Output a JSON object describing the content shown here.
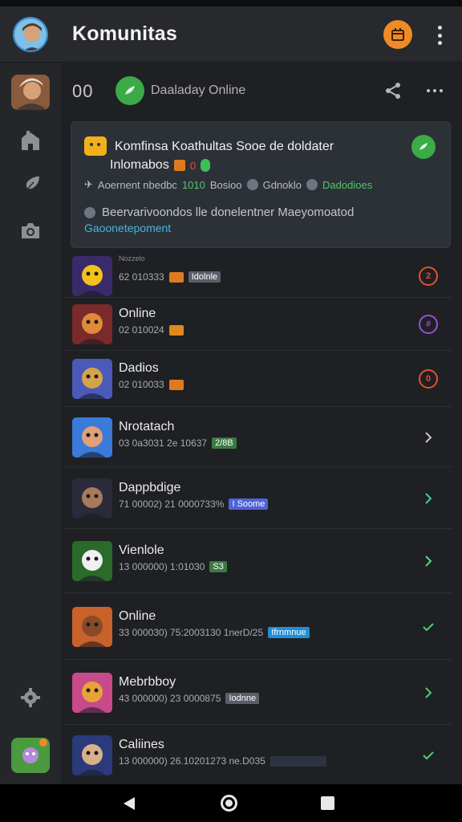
{
  "app": {
    "title": "Komunitas"
  },
  "channel": {
    "id": "00",
    "name": "Daaladay Online"
  },
  "card": {
    "title_line1": "Komfinsa Koathultas Sooe de doldater",
    "title_line2": "Inlomabos",
    "title_badge_num": "0",
    "meta_left": "Aoernent nbedbc",
    "meta_num": "1010",
    "meta_mid": "Bosioo",
    "meta_right": "Gdnoklo",
    "meta_green": "Dadodioes",
    "desc": "Beervarivoondos lle donelentner Maeyomoatod",
    "link": "Gaoonetepoment"
  },
  "rows": [
    {
      "name": "",
      "title_small": "Nozzelo",
      "sub": "62 010333",
      "tags": [
        {
          "text": "",
          "color": "#e07a1f"
        },
        {
          "text": "Idolnle",
          "color": "#5a5f6a"
        }
      ],
      "indicator": {
        "type": "circle",
        "text": "2",
        "color": "#e2522e"
      }
    },
    {
      "name": "Online",
      "sub": "02 010024",
      "tags": [
        {
          "text": "",
          "color": "#e0891f"
        }
      ],
      "indicator": {
        "type": "circle",
        "text": "#",
        "color": "#9b4fd6"
      }
    },
    {
      "name": "Dadios",
      "sub": "02 010033",
      "tags": [
        {
          "text": "",
          "color": "#e07a1f"
        }
      ],
      "indicator": {
        "type": "circle",
        "text": "0",
        "color": "#e2522e"
      }
    },
    {
      "name": "Nrotatach",
      "sub": "03 0a3031 2e 10637",
      "tags": [
        {
          "text": "2/8B",
          "color": "#3c7a44"
        }
      ],
      "indicator": {
        "type": "chevron",
        "color": "#c8c8cc"
      }
    },
    {
      "name": "Dappbdige",
      "sub": "71 00002) 21 0000733%",
      "tags": [
        {
          "text": "I Soome",
          "color": "#4f63d8"
        }
      ],
      "indicator": {
        "type": "chevron",
        "color": "#3ecfa6"
      }
    },
    {
      "name": "Vienlole",
      "sub": "13 000000) 1:01030",
      "tags": [
        {
          "text": "S3",
          "color": "#3c7a44"
        }
      ],
      "indicator": {
        "type": "chevron",
        "color": "#5fd48a"
      }
    },
    {
      "name": "Online",
      "sub": "33 000030) 75:2003130 1nerD/25",
      "tags": [
        {
          "text": "Ifrnmnue",
          "color": "#1f8fd6"
        }
      ],
      "indicator": {
        "type": "check",
        "color": "#4fcf6c"
      }
    },
    {
      "name": "Mebrbboy",
      "sub": "43 000000) 23 0000875",
      "tags": [
        {
          "text": "Iodnne",
          "color": "#5a5f6a"
        }
      ],
      "indicator": {
        "type": "chevron",
        "color": "#4fcf6c"
      }
    },
    {
      "name": "Caliines",
      "sub": "13 000000) 26.10201273 ne.D035",
      "tags": [
        {
          "text": "",
          "color": "#2d3440"
        }
      ],
      "indicator": {
        "type": "check",
        "color": "#4fcf6c"
      }
    }
  ],
  "colors": {
    "accent": "#f08a24",
    "online": "#3bab47",
    "link": "#46b4e0"
  },
  "icons": [
    "calendar-icon",
    "kebab-menu-icon",
    "share-icon",
    "more-icon",
    "home-icon",
    "feather-icon",
    "camera-icon",
    "settings-gear-icon",
    "back-icon",
    "home-circle-icon",
    "recents-icon"
  ]
}
